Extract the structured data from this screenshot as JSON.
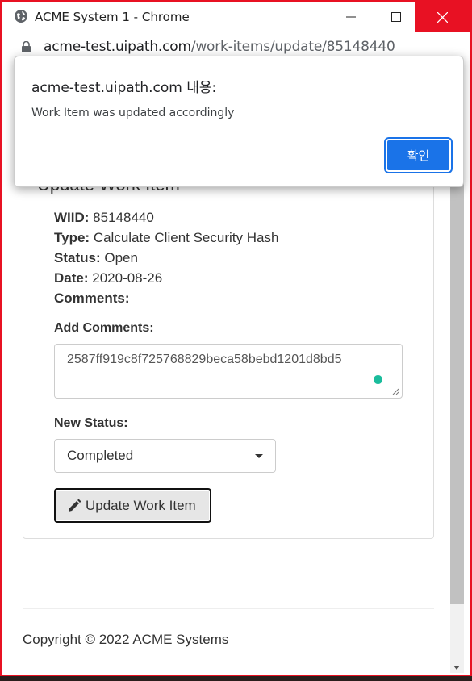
{
  "window": {
    "title": "ACME System 1 - Chrome",
    "url_host": "acme-test.uipath.com",
    "url_path": "/work-items/update/85148440"
  },
  "form": {
    "heading": "Update Work Item",
    "wiid_label": "WIID:",
    "wiid_value": "85148440",
    "type_label": "Type:",
    "type_value": "Calculate Client Security Hash",
    "status_label": "Status:",
    "status_value": "Open",
    "date_label": "Date:",
    "date_value": "2020-08-26",
    "comments_label": "Comments:",
    "add_comments_label": "Add Comments:",
    "add_comments_value": "2587ff919c8f725768829beca58bebd1201d8bd5",
    "new_status_label": "New Status:",
    "new_status_value": "Completed",
    "update_button": "Update Work Item"
  },
  "footer": {
    "copyright": "Copyright © 2022 ACME Systems"
  },
  "dialog": {
    "title": "acme-test.uipath.com 내용:",
    "message": "Work Item was updated accordingly",
    "ok_label": "확인"
  },
  "colors": {
    "accent": "#1a73e8",
    "close_red": "#e81123",
    "status_dot": "#1abc9c"
  }
}
